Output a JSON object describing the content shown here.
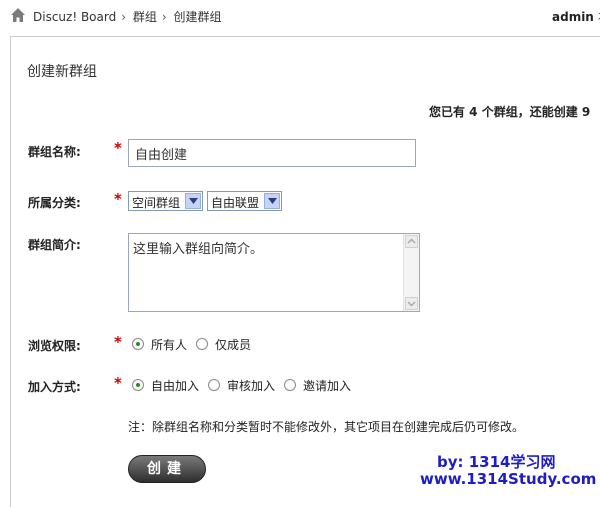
{
  "breadcrumb": [
    "Discuz! Board",
    "群组",
    "创建群组"
  ],
  "user": {
    "name": "admin",
    "extra": "右"
  },
  "page": {
    "title": "创建新群组",
    "quota": "您已有 4 个群组，还能创建 9"
  },
  "form": {
    "name_label": "群组名称:",
    "name_value": "自由创建",
    "category_label": "所属分类:",
    "category_primary": "空间群组",
    "category_secondary": "自由联盟",
    "intro_label": "群组简介:",
    "intro_value": "这里输入群组向简介。",
    "privacy_label": "浏览权限:",
    "privacy_options": [
      "所有人",
      "仅成员"
    ],
    "privacy_selected": "所有人",
    "join_label": "加入方式:",
    "join_options": [
      "自由加入",
      "审核加入",
      "邀请加入"
    ],
    "join_selected": "自由加入",
    "required_mark": "*",
    "note": "注：除群组名称和分类暂时不能修改外，其它项目在创建完成后仍可修改。",
    "submit_label": "创建"
  },
  "watermark": {
    "line1": "by: 1314学习网",
    "line2": "www.1314Study.com"
  },
  "colors": {
    "required": "#d40000",
    "watermark": "#1c1cc8",
    "radio_checked": "#2a8a2a"
  }
}
